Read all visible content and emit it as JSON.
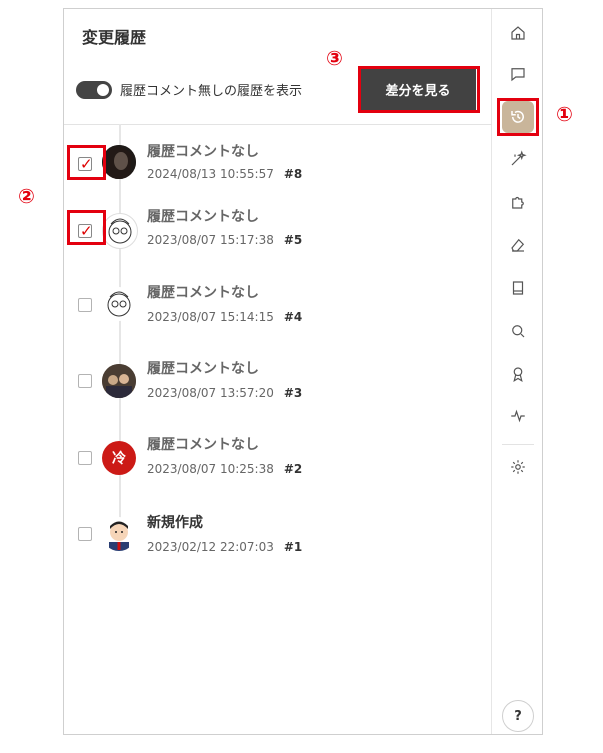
{
  "panel": {
    "title": "変更履歴",
    "toggle_label": "履歴コメント無しの履歴を表示",
    "diff_button_label": "差分を見る"
  },
  "history": [
    {
      "title": "履歴コメントなし",
      "date": "2024/08/13 10:55:57",
      "rev": "#8",
      "checked": true,
      "avatar": "photo-woman"
    },
    {
      "title": "履歴コメントなし",
      "date": "2023/08/07 15:17:38",
      "rev": "#5",
      "checked": true,
      "avatar": "sketch-face"
    },
    {
      "title": "履歴コメントなし",
      "date": "2023/08/07 15:14:15",
      "rev": "#4",
      "checked": false,
      "avatar": "sketch-face"
    },
    {
      "title": "履歴コメントなし",
      "date": "2023/08/07 13:57:20",
      "rev": "#3",
      "checked": false,
      "avatar": "photo-group"
    },
    {
      "title": "履歴コメントなし",
      "date": "2023/08/07 10:25:38",
      "rev": "#2",
      "checked": false,
      "avatar": "red-circle",
      "avatar_text": "冷"
    },
    {
      "title": "新規作成",
      "date": "2023/02/12 22:07:03",
      "rev": "#1",
      "checked": false,
      "avatar": "cartoon-man"
    }
  ],
  "sidebar_icons": [
    "home-icon",
    "comment-icon",
    "history-icon",
    "magic-icon",
    "puzzle-icon",
    "eraser-icon",
    "book-icon",
    "search-icon",
    "award-icon",
    "activity-icon",
    "settings-icon"
  ],
  "help_label": "?",
  "callouts": [
    "①",
    "②",
    "③"
  ],
  "colors": {
    "accent_red": "#e3000f",
    "button_dark": "#424242",
    "history_active": "#c9b59a"
  }
}
